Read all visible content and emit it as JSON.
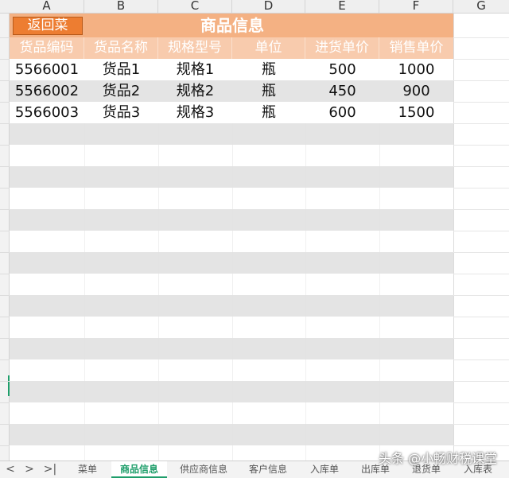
{
  "column_headers": [
    "A",
    "B",
    "C",
    "D",
    "E",
    "F",
    "G"
  ],
  "back_button": "返回菜",
  "title": "商品信息",
  "table_headers": [
    "货品编码",
    "货品名称",
    "规格型号",
    "单位",
    "进货单价",
    "销售单价"
  ],
  "rows": [
    [
      "5566001",
      "货品1",
      "规格1",
      "瓶",
      "500",
      "1000"
    ],
    [
      "5566002",
      "货品2",
      "规格2",
      "瓶",
      "450",
      "900"
    ],
    [
      "5566003",
      "货品3",
      "规格3",
      "瓶",
      "600",
      "1500"
    ]
  ],
  "sheet_nav": {
    "prev": "<",
    "next": ">",
    "last": ">|"
  },
  "sheet_tabs": [
    "菜单",
    "商品信息",
    "供应商信息",
    "客户信息",
    "入库单",
    "出库单",
    "退货单",
    "入库表"
  ],
  "active_tab": "商品信息",
  "watermark": "头条 @小畅财税课堂",
  "colors": {
    "title_bg": "#f4b183",
    "header_bg": "#f8cbad",
    "button_bg": "#ed7d31",
    "band_gray": "#e4e4e4",
    "active_tab": "#1e9e6a"
  }
}
